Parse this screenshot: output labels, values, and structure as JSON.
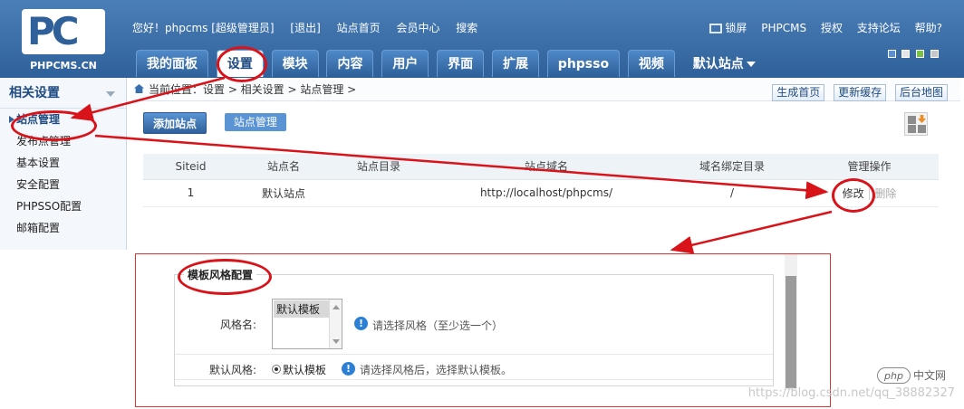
{
  "header": {
    "logo_text": "PC",
    "logo_domain": "PHPCMS.CN",
    "welcome": "您好！phpcms [超级管理员]",
    "logout": "[退出]",
    "links": [
      "站点首页",
      "会员中心",
      "搜索"
    ],
    "right_links": [
      "锁屏",
      "PHPCMS",
      "授权",
      "支持论坛",
      "帮助?"
    ],
    "theme_swatches": [
      "#5b8fd0",
      "#e6e6e6",
      "#7bc043",
      "#c8c8c8"
    ]
  },
  "nav": {
    "tabs": [
      "我的面板",
      "设置",
      "模块",
      "内容",
      "用户",
      "界面",
      "扩展",
      "phpsso",
      "视频"
    ],
    "active_tab": "设置",
    "site_selector": "默认站点"
  },
  "sidebar": {
    "title": "相关设置",
    "items": [
      "站点管理",
      "发布点管理",
      "基本设置",
      "安全配置",
      "PHPSSO配置",
      "邮箱配置"
    ],
    "active_item": "站点管理"
  },
  "breadcrumb": {
    "text": "当前位置：设置 > 相关设置 > 站点管理 >",
    "buttons": [
      "生成首页",
      "更新缓存",
      "后台地图"
    ]
  },
  "actions": {
    "add_site": "添加站点",
    "manage_site": "站点管理"
  },
  "table": {
    "columns": [
      "Siteid",
      "站点名",
      "站点目录",
      "站点域名",
      "域名绑定目录",
      "管理操作"
    ],
    "rows": [
      {
        "siteid": "1",
        "name": "默认站点",
        "dir": "",
        "domain": "http://localhost/phpcms/",
        "bind_dir": "/",
        "edit": "修改",
        "delete": "删除"
      }
    ]
  },
  "template_config": {
    "legend": "模板风格配置",
    "style_label": "风格名:",
    "style_option": "默认模板",
    "style_hint": "请选择风格（至少选一个）",
    "default_label": "默认风格:",
    "default_option": "默认模板",
    "default_hint": "请选择风格后，选择默认模板。"
  },
  "watermark": {
    "badge": "php",
    "badge_cn": "中文网",
    "url": "https://blog.csdn.net/qq_38882327"
  },
  "colors": {
    "header_blue": "#2f609a",
    "annotation_red": "#d9131a"
  }
}
